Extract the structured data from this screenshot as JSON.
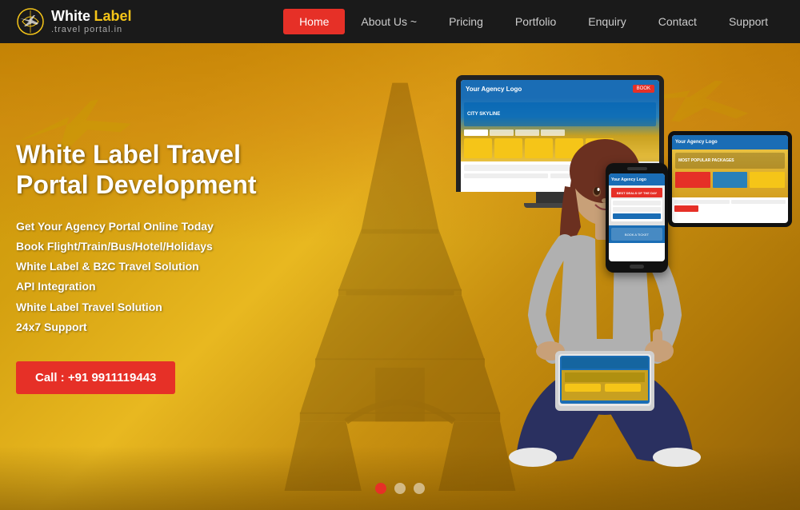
{
  "logo": {
    "white": "White",
    "label": "Label",
    "sub": ".travel portal.in"
  },
  "nav": {
    "items": [
      {
        "id": "home",
        "label": "Home",
        "active": true
      },
      {
        "id": "about",
        "label": "About Us ~",
        "active": false
      },
      {
        "id": "pricing",
        "label": "Pricing",
        "active": false
      },
      {
        "id": "portfolio",
        "label": "Portfolio",
        "active": false
      },
      {
        "id": "enquiry",
        "label": "Enquiry",
        "active": false
      },
      {
        "id": "contact",
        "label": "Contact",
        "active": false
      },
      {
        "id": "support",
        "label": "Support",
        "active": false
      }
    ]
  },
  "hero": {
    "title": "White Label Travel Portal Development",
    "list": [
      "Get Your Agency Portal Online Today",
      "Book Flight/Train/Bus/Hotel/Holidays",
      "White Label & B2C Travel Solution",
      "API Integration",
      "White Label Travel Solution",
      "24x7 Support"
    ],
    "call_btn": "Call : +91 9911119443",
    "dots": [
      {
        "active": true
      },
      {
        "active": false
      },
      {
        "active": false
      }
    ]
  },
  "monitor": {
    "logo": "Your Agency Logo",
    "btn": "BOOK"
  },
  "tablet": {
    "logo": "Your Agency Logo",
    "banner": "MOST POPULAR PACKAGES"
  },
  "phone": {
    "logo": "Your Agency Logo",
    "deal": "BEST DEALS OF THE DAY"
  }
}
